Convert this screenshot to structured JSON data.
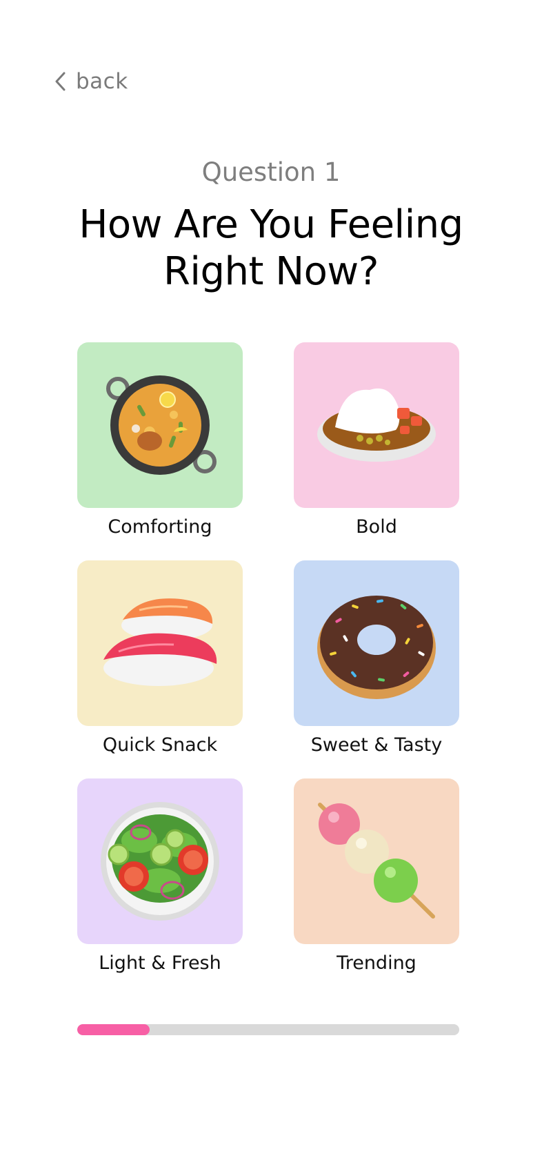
{
  "nav": {
    "back_label": "back"
  },
  "question": {
    "label": "Question 1",
    "title_line1": "How Are You Feeling",
    "title_line2": "Right Now?"
  },
  "options": [
    {
      "label": "Comforting",
      "icon": "paella-pan-icon",
      "color": "#c2ebc2"
    },
    {
      "label": "Bold",
      "icon": "curry-rice-icon",
      "color": "#f9cbe3"
    },
    {
      "label": "Quick Snack",
      "icon": "sushi-icon",
      "color": "#f7ecc6"
    },
    {
      "label": "Sweet & Tasty",
      "icon": "donut-icon",
      "color": "#c6d9f5"
    },
    {
      "label": "Light & Fresh",
      "icon": "salad-icon",
      "color": "#e7d5fb"
    },
    {
      "label": "Trending",
      "icon": "dango-icon",
      "color": "#f8d8c2"
    }
  ],
  "progress": {
    "fraction": 0.19,
    "fill_color": "#f75fa5",
    "track_color": "#d9d9d9"
  }
}
